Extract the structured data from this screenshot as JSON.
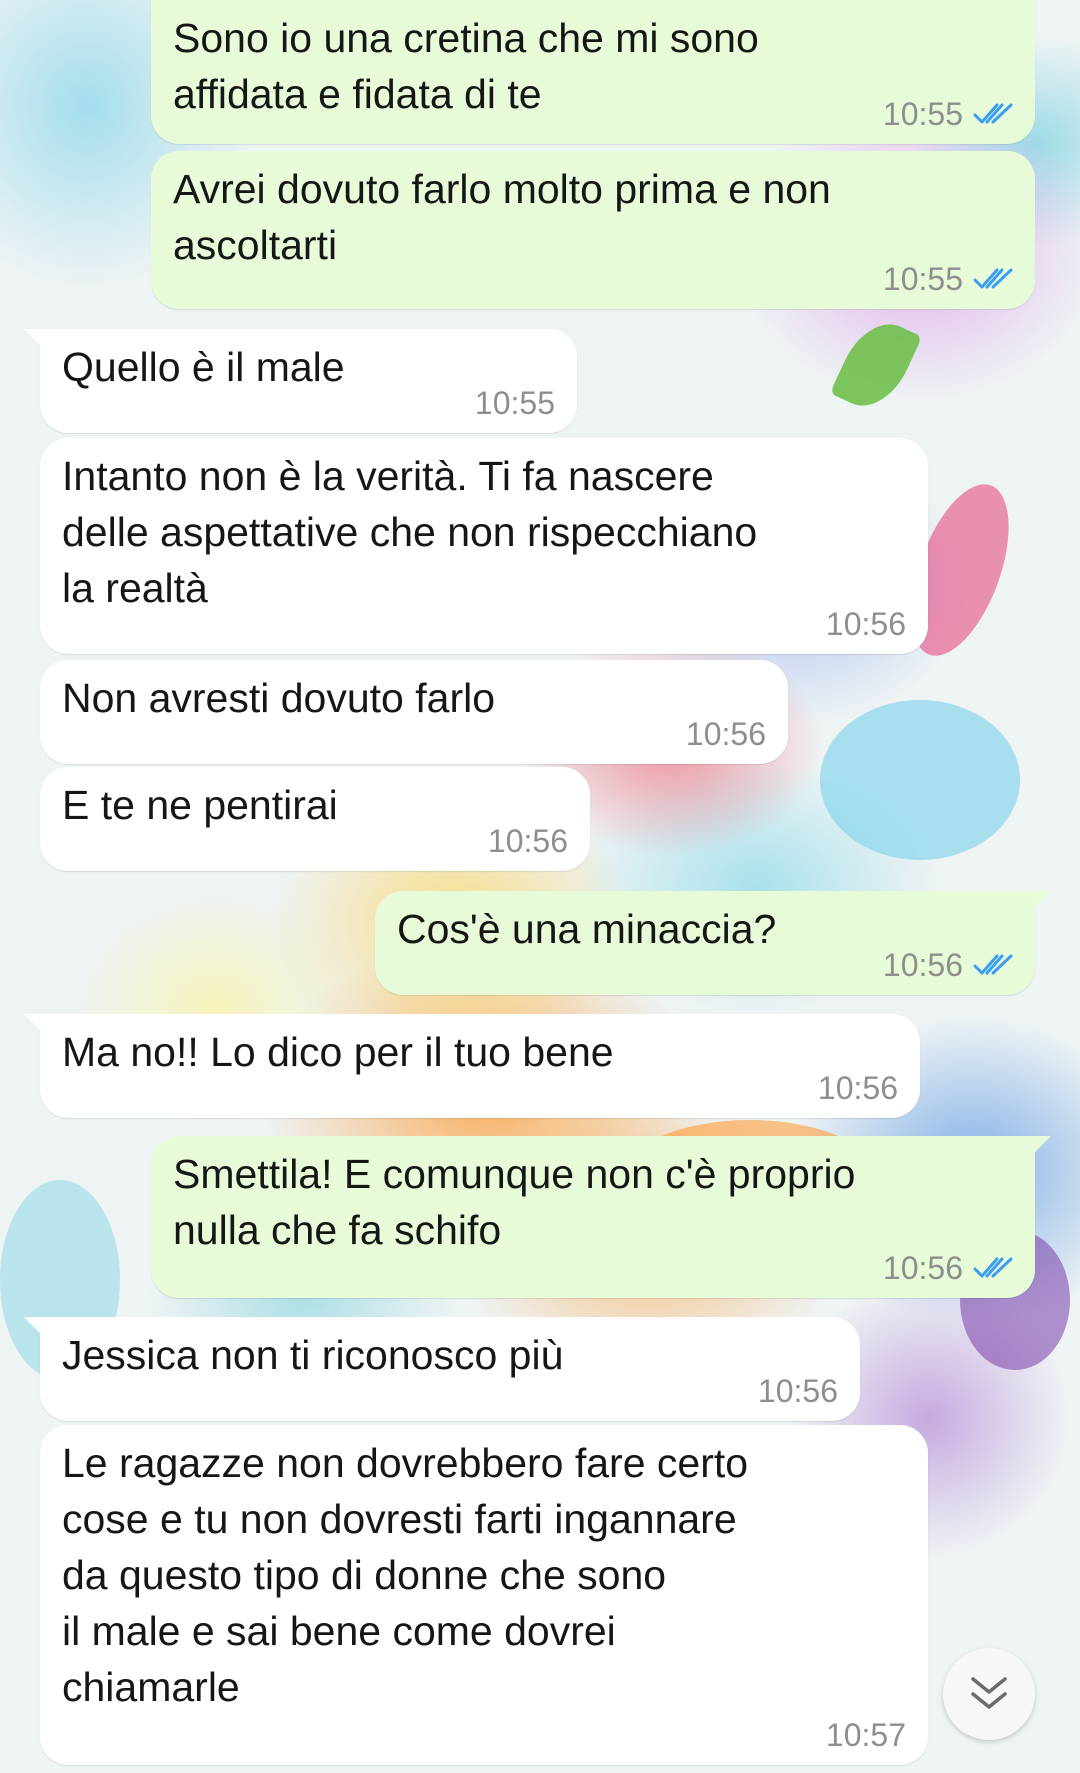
{
  "chat": {
    "messages": [
      {
        "direction": "outgoing",
        "text": "Sono io una cretina che mi sono\naffidata e fidata di te",
        "time": "10:55",
        "status": "read"
      },
      {
        "direction": "outgoing",
        "text": "Avrei dovuto farlo molto prima e non\nascoltarti",
        "time": "10:55",
        "status": "read"
      },
      {
        "direction": "incoming",
        "text": "Quello è il male",
        "time": "10:55"
      },
      {
        "direction": "incoming",
        "text": "Intanto non è la verità. Ti fa nascere\ndelle aspettative che non rispecchiano\nla realtà",
        "time": "10:56"
      },
      {
        "direction": "incoming",
        "text": "Non avresti dovuto farlo",
        "time": "10:56"
      },
      {
        "direction": "incoming",
        "text": "E te ne pentirai",
        "time": "10:56"
      },
      {
        "direction": "outgoing",
        "text": "Cos'è una minaccia?",
        "time": "10:56",
        "status": "read"
      },
      {
        "direction": "incoming",
        "text": "Ma no!! Lo dico per il tuo bene",
        "time": "10:56"
      },
      {
        "direction": "outgoing",
        "text": "Smettila! E comunque non c'è proprio\nnulla che fa schifo",
        "time": "10:56",
        "status": "read"
      },
      {
        "direction": "incoming",
        "text": "Jessica non ti riconosco più",
        "time": "10:56"
      },
      {
        "direction": "incoming",
        "text": "Le ragazze non dovrebbero fare certo\ncose e tu non dovresti farti ingannare\nda questo tipo di donne che sono\nil male e sai bene come dovrei\nchiamarle",
        "time": "10:57"
      }
    ],
    "scroll_down_icon": "double-chevron-down-icon"
  },
  "colors": {
    "incoming_bubble": "#ffffff",
    "outgoing_bubble": "#e7fbd9",
    "read_ticks": "#3b9ef0",
    "timestamp": "#8e8e8e"
  }
}
